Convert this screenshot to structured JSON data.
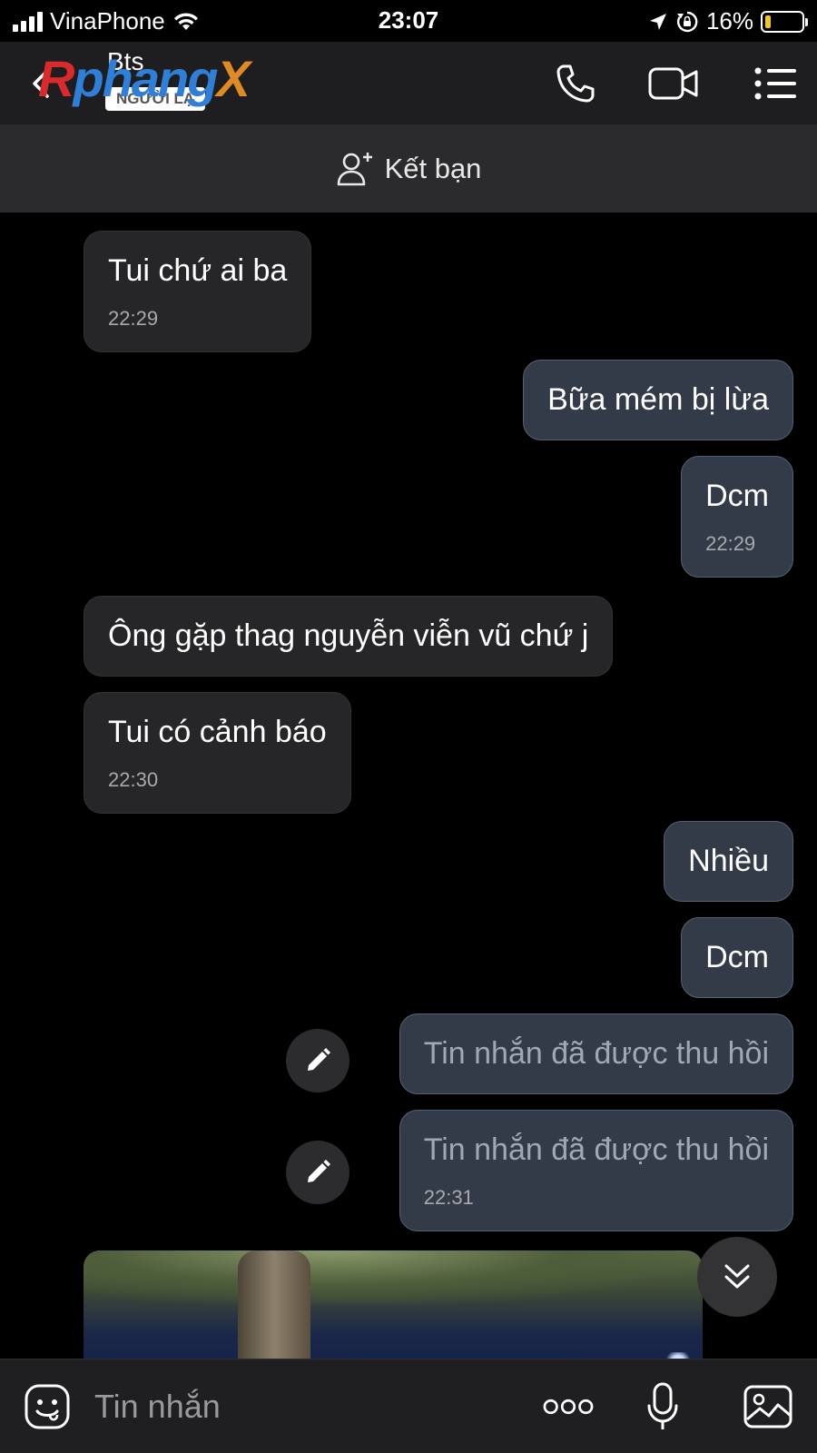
{
  "status_bar": {
    "carrier": "VinaPhone",
    "time": "23:07",
    "battery": "16%",
    "battery_level": 0.16,
    "icons": [
      "signal-icon",
      "wifi-icon",
      "location-icon",
      "orientation-lock-icon",
      "battery-icon"
    ]
  },
  "header": {
    "contact_name": "Bts",
    "badge": "NGƯỜI LẠ",
    "watermark": [
      "R",
      "phang",
      "",
      "X"
    ],
    "watermark_text": "Rphangx",
    "icons": [
      "back-icon",
      "phone-icon",
      "video-call-icon",
      "menu-list-icon"
    ]
  },
  "add_friend": {
    "label": "Kết bạn",
    "icon": "add-friend-icon"
  },
  "messages": [
    {
      "direction": "in",
      "text": "Tui chứ ai ba",
      "time": "22:29"
    },
    {
      "direction": "out",
      "text": "Bữa mém bị lừa",
      "time": ""
    },
    {
      "direction": "out",
      "text": "Dcm",
      "time": "22:29"
    },
    {
      "direction": "in",
      "text": "Ông gặp thag nguyễn viễn vũ chứ j",
      "time": ""
    },
    {
      "direction": "in",
      "text": "Tui có cảnh báo",
      "time": "22:30"
    },
    {
      "direction": "out",
      "text": "Nhiều",
      "time": ""
    },
    {
      "direction": "out",
      "text": "Dcm",
      "time": ""
    },
    {
      "direction": "out",
      "text": "Tin nhắn đã được thu hồi",
      "time": "",
      "recalled": true
    },
    {
      "direction": "out",
      "text": "Tin nhắn đã được thu hồi",
      "time": "22:31",
      "recalled": true
    }
  ],
  "photo_message": {
    "direction": "in",
    "icon": "photo-thumbnail"
  },
  "input_bar": {
    "placeholder": "Tin nhắn",
    "icons": [
      "sticker-icon",
      "more-icon",
      "microphone-icon",
      "image-icon"
    ]
  },
  "colors": {
    "background": "#000000",
    "header": "#1e1e20",
    "incoming_bubble": "#262628",
    "outgoing_bubble": "#343b48",
    "outgoing_border": "#56606f",
    "battery_low": "#f5c518"
  }
}
